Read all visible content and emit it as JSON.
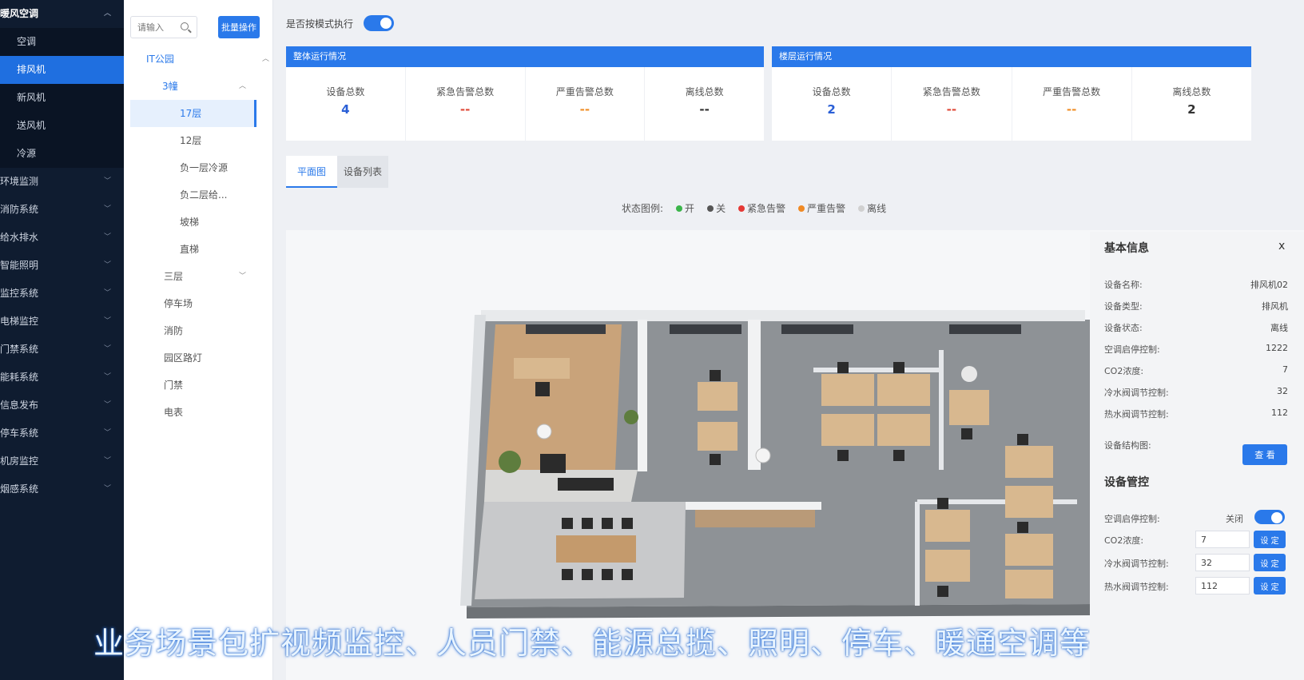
{
  "sidebar": {
    "items": [
      {
        "label": "暖风空调",
        "type": "top",
        "expanded": true
      },
      {
        "label": "空调",
        "type": "sub"
      },
      {
        "label": "排风机",
        "type": "sub",
        "active": true
      },
      {
        "label": "新风机",
        "type": "sub"
      },
      {
        "label": "送风机",
        "type": "sub"
      },
      {
        "label": "冷源",
        "type": "sub"
      },
      {
        "label": "环境监测",
        "type": "top"
      },
      {
        "label": "消防系统",
        "type": "top"
      },
      {
        "label": "给水排水",
        "type": "top"
      },
      {
        "label": "智能照明",
        "type": "top"
      },
      {
        "label": "监控系统",
        "type": "top"
      },
      {
        "label": "电梯监控",
        "type": "top"
      },
      {
        "label": "门禁系统",
        "type": "top"
      },
      {
        "label": "能耗系统",
        "type": "top"
      },
      {
        "label": "信息发布",
        "type": "top"
      },
      {
        "label": "停车系统",
        "type": "top"
      },
      {
        "label": "机房监控",
        "type": "top"
      },
      {
        "label": "烟感系统",
        "type": "top"
      }
    ]
  },
  "tree": {
    "search_placeholder": "请输入",
    "batch_label": "批量操作",
    "nodes": [
      {
        "label": "IT公园",
        "level": 0,
        "expanded": true
      },
      {
        "label": "3幢",
        "level": 1,
        "expanded": true
      },
      {
        "label": "17层",
        "level": 2,
        "selected": true
      },
      {
        "label": "12层",
        "level": 2
      },
      {
        "label": "负一层冷源",
        "level": 2
      },
      {
        "label": "负二层给...",
        "level": 2
      },
      {
        "label": "坡梯",
        "level": 2
      },
      {
        "label": "直梯",
        "level": 2
      },
      {
        "label": "三层",
        "level": 1,
        "collapsed": true
      },
      {
        "label": "停车场",
        "level": 1
      },
      {
        "label": "消防",
        "level": 1
      },
      {
        "label": "园区路灯",
        "level": 1
      },
      {
        "label": "门禁",
        "level": 1
      },
      {
        "label": "电表",
        "level": 1
      }
    ]
  },
  "header": {
    "mode_label": "是否按模式执行",
    "mode_on": true
  },
  "overall": {
    "title": "整体运行情况",
    "stats": [
      {
        "label": "设备总数",
        "value": "4",
        "color": "#2a5fd6"
      },
      {
        "label": "紧急告警总数",
        "value": "--",
        "color": "#e04a3a"
      },
      {
        "label": "严重告警总数",
        "value": "--",
        "color": "#f0902a"
      },
      {
        "label": "离线总数",
        "value": "--",
        "color": "#333333"
      }
    ]
  },
  "floor": {
    "title": "楼层运行情况",
    "stats": [
      {
        "label": "设备总数",
        "value": "2",
        "color": "#2a5fd6"
      },
      {
        "label": "紧急告警总数",
        "value": "--",
        "color": "#e04a3a"
      },
      {
        "label": "严重告警总数",
        "value": "--",
        "color": "#f0902a"
      },
      {
        "label": "离线总数",
        "value": "2",
        "color": "#333333"
      }
    ]
  },
  "tabs": [
    {
      "label": "平面图",
      "active": true
    },
    {
      "label": "设备列表",
      "active": false
    }
  ],
  "legend": {
    "title": "状态图例:",
    "items": [
      {
        "label": "开",
        "color": "#3bb54a"
      },
      {
        "label": "关",
        "color": "#555555"
      },
      {
        "label": "紧急告警",
        "color": "#e53935"
      },
      {
        "label": "严重告警",
        "color": "#f08a24"
      },
      {
        "label": "离线",
        "color": "#d0d0d0"
      }
    ]
  },
  "info": {
    "basic_title": "基本信息",
    "close": "x",
    "fields": [
      {
        "label": "设备名称:",
        "value": "排风机02"
      },
      {
        "label": "设备类型:",
        "value": "排风机"
      },
      {
        "label": "设备状态:",
        "value": "离线"
      },
      {
        "label": "空调启停控制:",
        "value": "1222"
      },
      {
        "label": "CO2浓度:",
        "value": "7"
      },
      {
        "label": "冷水阀调节控制:",
        "value": "32"
      },
      {
        "label": "热水阀调节控制:",
        "value": "112"
      }
    ],
    "structure_label": "设备结构图:",
    "view_btn": "查 看",
    "control_title": "设备管控",
    "controls": {
      "switch_label": "空调启停控制:",
      "switch_state": "关闭",
      "rows": [
        {
          "label": "CO2浓度:",
          "value": "7",
          "btn": "设 定"
        },
        {
          "label": "冷水阀调节控制:",
          "value": "32",
          "btn": "设 定"
        },
        {
          "label": "热水阀调节控制:",
          "value": "112",
          "btn": "设 定"
        }
      ]
    }
  },
  "subtitle": "业务场景包扩视频监控、人员门禁、能源总揽、照明、停车、暖通空调等"
}
